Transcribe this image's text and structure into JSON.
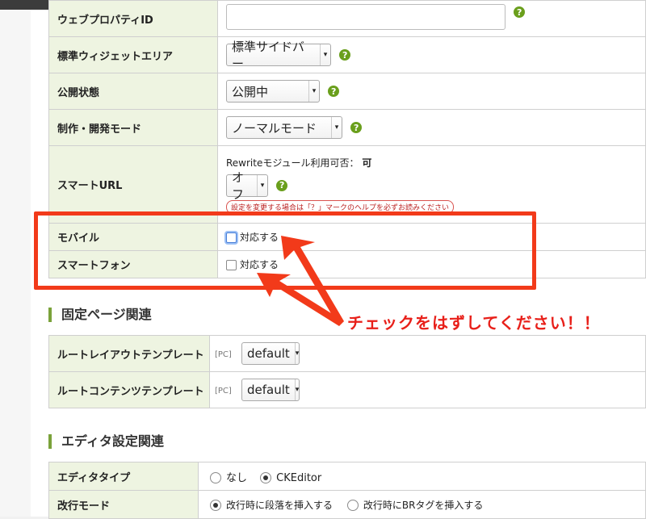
{
  "form": {
    "web_property": {
      "label": "ウェブプロパティID",
      "value": ""
    },
    "widget_area": {
      "label": "標準ウィジェットエリア",
      "value": "標準サイドバー"
    },
    "publish": {
      "label": "公開状態",
      "value": "公開中"
    },
    "mode": {
      "label": "制作・開発モード",
      "value": "ノーマルモード"
    },
    "smart_url": {
      "label": "スマートURL",
      "rewrite_label": "Rewriteモジュール利用可否：",
      "rewrite_value": "可",
      "value": "オフ",
      "note": "設定を変更する場合は「？」マークのヘルプを必ずお読みください"
    },
    "mobile": {
      "label": "モバイル",
      "checkbox_label": "対応する",
      "checked": false
    },
    "smartphone": {
      "label": "スマートフォン",
      "checkbox_label": "対応する",
      "checked": false
    }
  },
  "help_icon": "?",
  "fixed_page": {
    "title": "固定ページ関連",
    "rows": [
      {
        "label": "ルートレイアウトテンプレート",
        "prefix": "[PC]",
        "value": "default"
      },
      {
        "label": "ルートコンテンツテンプレート",
        "prefix": "[PC]",
        "value": "default"
      }
    ]
  },
  "editor": {
    "title": "エディタ設定関連",
    "type": {
      "label": "エディタタイプ",
      "options": [
        "なし",
        "CKEditor"
      ],
      "selected": "CKEditor"
    },
    "linebreak": {
      "label": "改行モード",
      "options": [
        "改行時に段落を挿入する",
        "改行時にBRタグを挿入する"
      ],
      "selected": "改行時に段落を挿入する"
    }
  },
  "annotation": {
    "text": "チェックをはずしてください！！",
    "color": "#f23a1a"
  },
  "colors": {
    "label_bg": "#eef4e1",
    "accent": "#7aa23a",
    "help": "#6a9f1c"
  },
  "icons": {
    "help": "question-circle-icon",
    "select_arrow": "chevron-down-icon"
  }
}
